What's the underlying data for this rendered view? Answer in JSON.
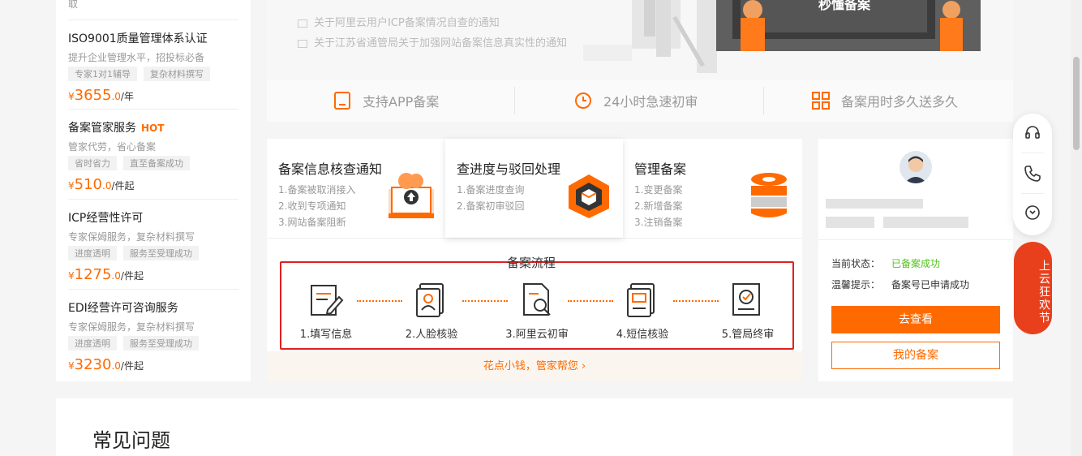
{
  "left_panel": {
    "top_fragment": "取",
    "services": [
      {
        "title": "ISO9001质量管理体系认证",
        "hot": "",
        "desc": "提升企业管理水平，招投标必备",
        "tags": [
          "专家1对1辅导",
          "复杂材料撰写"
        ],
        "currency": "¥",
        "price_int": "3655",
        "price_dec": ".0",
        "unit": "/年"
      },
      {
        "title": "备案管家服务",
        "hot": "HOT",
        "desc": "管家代劳，省心备案",
        "tags": [
          "省时省力",
          "直至备案成功"
        ],
        "currency": "¥",
        "price_int": "510",
        "price_dec": ".0",
        "unit": "/件起"
      },
      {
        "title": "ICP经营性许可",
        "hot": "",
        "desc": "专家保姆服务，复杂材料撰写",
        "tags": [
          "进度透明",
          "服务至受理成功"
        ],
        "currency": "¥",
        "price_int": "1275",
        "price_dec": ".0",
        "unit": "/件起"
      },
      {
        "title": "EDI经营许可咨询服务",
        "hot": "",
        "desc": "专家保姆服务，复杂材料撰写",
        "tags": [
          "进度透明",
          "服务至受理成功"
        ],
        "currency": "¥",
        "price_int": "3230",
        "price_dec": ".0",
        "unit": "/件起"
      }
    ]
  },
  "banner": {
    "notices": [
      "关于阿里云用户ICP备案情况自查的通知",
      "关于江苏省通管局关于加强网站备案信息真实性的通知"
    ],
    "video_title": "秒懂备案"
  },
  "features": [
    "支持APP备案",
    "24小时急速初审",
    "备案用时多久送多久"
  ],
  "cards": [
    {
      "title": "备案信息核查通知",
      "items": [
        "1.备案被取消接入",
        "2.收到专项通知",
        "3.网站备案阻断"
      ]
    },
    {
      "title": "查进度与驳回处理",
      "items": [
        "1.备案进度查询",
        "2.备案初审驳回"
      ]
    },
    {
      "title": "管理备案",
      "items": [
        "1.变更备案",
        "2.新增备案",
        "3.注销备案"
      ]
    }
  ],
  "flow": {
    "title": "备案流程",
    "steps": [
      "1.填写信息",
      "2.人脸核验",
      "3.阿里云初审",
      "4.短信核验",
      "5.管局终审"
    ],
    "footer": "花点小钱，管家帮您 ›"
  },
  "account": {
    "status_label": "当前状态：",
    "status_value": "已备案成功",
    "tip_label": "温馨提示：",
    "tip_value": "备案号已申请成功",
    "view_button": "去查看",
    "my_button": "我的备案",
    "status_color": "#52c41a"
  },
  "promo": "上云狂欢节",
  "faq": {
    "title": "常见问题"
  },
  "colors": {
    "accent": "#ff6a00",
    "highlight_border": "#e02020"
  }
}
